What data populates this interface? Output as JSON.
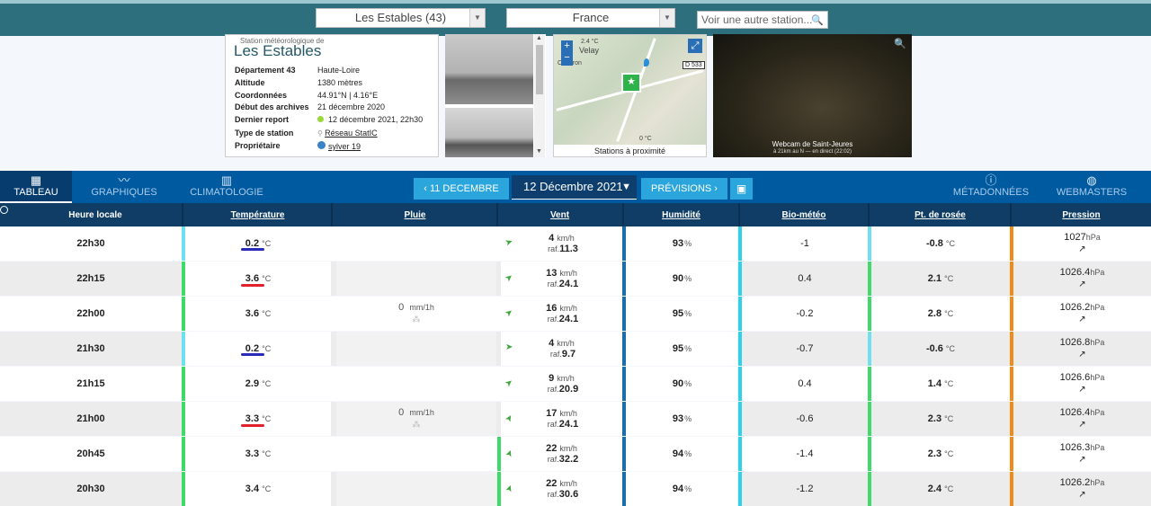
{
  "topbar": {
    "station_select": "Les Estables (43)",
    "country_select": "France",
    "search_placeholder": "Voir une autre station..."
  },
  "station": {
    "subtitle": "Station météorologique de",
    "name": "Les Estables",
    "rows": [
      {
        "key": "Département 43",
        "value": "Haute-Loire"
      },
      {
        "key": "Altitude",
        "value": "1380 mètres"
      },
      {
        "key": "Coordonnées",
        "value": "44.91°N | 4.16°E"
      },
      {
        "key": "Début des archives",
        "value": "21 décembre 2020"
      },
      {
        "key": "Dernier report",
        "value": "12 décembre 2021, 22h30"
      },
      {
        "key": "Type de station",
        "value": "Réseau StatIC"
      },
      {
        "key": "Propriétaire",
        "value": "sylver 19"
      }
    ]
  },
  "map": {
    "caption": "Stations à proximité",
    "road_label": "D 533",
    "zoom_in": "+",
    "zoom_out": "−",
    "labels": [
      "2.4 °C",
      "Velay",
      "Chadron",
      "0 °C"
    ]
  },
  "webcam": {
    "caption": "Webcam de Saint-Jeures",
    "subcaption": "à 21km au N — en direct (22:02)"
  },
  "nav": {
    "tabs": [
      {
        "label": "TABLEAU",
        "icon": "table-icon"
      },
      {
        "label": "GRAPHIQUES",
        "icon": "chart-line-icon"
      },
      {
        "label": "CLIMATOLOGIE",
        "icon": "bar-chart-icon"
      }
    ],
    "prev_day": "11 DECEMBRE",
    "date": "12 Décembre 2021",
    "forecast": "PRÉVISIONS",
    "right_tabs": [
      {
        "label": "MÉTADONNÉES",
        "icon": "info-icon"
      },
      {
        "label": "WEBMASTERS",
        "icon": "globe-icon"
      }
    ]
  },
  "table": {
    "headers": [
      "Heure locale",
      "Température",
      "Pluie",
      "Vent",
      "Humidité",
      "Bio-météo",
      "Pt. de rosée",
      "Pression"
    ],
    "units": {
      "temp": "°C",
      "rain": "mm/1h",
      "wind": "km/h",
      "gust": "raf.",
      "hum": "%",
      "press": "hPa"
    },
    "rows": [
      {
        "time": "22h30",
        "temp": "0.2",
        "rain": "",
        "wind": "4",
        "gust": "11.3",
        "hum": "93",
        "bio": "-1",
        "dew": "-0.8",
        "press": "1027"
      },
      {
        "time": "22h15",
        "temp": "3.6",
        "rain": "",
        "wind": "13",
        "gust": "24.1",
        "hum": "90",
        "bio": "0.4",
        "dew": "2.1",
        "press": "1026.4"
      },
      {
        "time": "22h00",
        "temp": "3.6",
        "rain": "0",
        "wind": "16",
        "gust": "24.1",
        "hum": "95",
        "bio": "-0.2",
        "dew": "2.8",
        "press": "1026.2"
      },
      {
        "time": "21h30",
        "temp": "0.2",
        "rain": "",
        "wind": "4",
        "gust": "9.7",
        "hum": "95",
        "bio": "-0.7",
        "dew": "-0.6",
        "press": "1026.8"
      },
      {
        "time": "21h15",
        "temp": "2.9",
        "rain": "",
        "wind": "9",
        "gust": "20.9",
        "hum": "90",
        "bio": "0.4",
        "dew": "1.4",
        "press": "1026.6"
      },
      {
        "time": "21h00",
        "temp": "3.3",
        "rain": "0",
        "wind": "17",
        "gust": "24.1",
        "hum": "93",
        "bio": "-0.6",
        "dew": "2.3",
        "press": "1026.4"
      },
      {
        "time": "20h45",
        "temp": "3.3",
        "rain": "",
        "wind": "22",
        "gust": "32.2",
        "hum": "94",
        "bio": "-1.4",
        "dew": "2.3",
        "press": "1026.3"
      },
      {
        "time": "20h30",
        "temp": "3.4",
        "rain": "",
        "wind": "22",
        "gust": "30.6",
        "hum": "94",
        "bio": "-1.2",
        "dew": "2.4",
        "press": "1026.2"
      }
    ]
  },
  "colors": {
    "temp_cold": "#6fe0ef",
    "temp_mild": "#40d96a",
    "wind_light": "#40d96a",
    "humidity": "#1b6fa8",
    "bio": "#2bd3ef",
    "dew_cold": "#6fe0ef",
    "dew_mild": "#40d96a",
    "pressure": "#f08a18",
    "annotation_blue": "#2a2ab8",
    "annotation_red": "#e0202a"
  }
}
